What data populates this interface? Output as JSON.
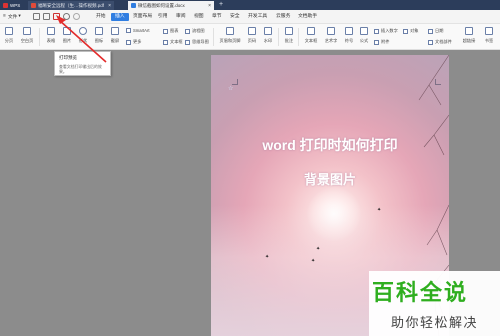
{
  "tabs": {
    "wps": "WPS",
    "doc1": "福晰安全远程（生…操作视频.pdf",
    "doc2": "微信截图如何设置.docx",
    "add": "+"
  },
  "menu": {
    "file": "文件",
    "tabs": [
      "开始",
      "插入",
      "页面布局",
      "引用",
      "审阅",
      "视图",
      "章节",
      "安全",
      "开发工具",
      "云服务",
      "文档助手"
    ],
    "active_index": 1
  },
  "toolbar": {
    "row1": [
      "分页",
      "空白页",
      "表格",
      "图片",
      "形状",
      "图标",
      "截屏",
      "流程",
      "思维导图",
      "页眉和页脚",
      "页码",
      "水印",
      "批注",
      "文本框",
      "艺术字",
      "符号",
      "公式",
      "超链接",
      "书签"
    ],
    "smartart": "SmartArt",
    "chart": "图表",
    "flowchart": "流程图",
    "mindmap": "思维导图",
    "more": "更多",
    "textbox": "文本框",
    "insert_number": "插入数字",
    "object": "对象",
    "date": "日期",
    "attachment": "附件",
    "docparts": "文档部件"
  },
  "tooltip": {
    "title": "打印预览",
    "desc": "查看文档打印输出后的效果。"
  },
  "document": {
    "title_line1": "word 打印时如何打印",
    "title_line2": "背景图片"
  },
  "watermark": {
    "brand": "百科全说",
    "tagline": "助你轻松解决"
  },
  "colors": {
    "tabbar": "#2c3d5b",
    "accent": "#2f7de1",
    "arrow": "#e32b2b",
    "watermark_green": "#2fae1f"
  }
}
